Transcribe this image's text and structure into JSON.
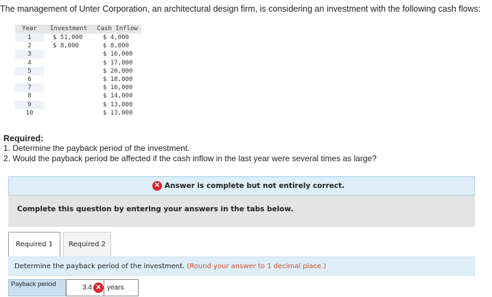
{
  "intro": "The management of Unter Corporation, an architectural design firm, is considering an investment with the following cash flows:",
  "table": {
    "headers": [
      "Year",
      "Investment",
      "Cash Inflow"
    ],
    "rows": [
      {
        "year": "1",
        "investment": "$ 51,000",
        "inflow": "$ 4,000"
      },
      {
        "year": "2",
        "investment": "$ 8,000",
        "inflow": "$ 8,000"
      },
      {
        "year": "3",
        "investment": "",
        "inflow": "$ 16,000"
      },
      {
        "year": "4",
        "investment": "",
        "inflow": "$ 17,000"
      },
      {
        "year": "5",
        "investment": "",
        "inflow": "$ 20,000"
      },
      {
        "year": "6",
        "investment": "",
        "inflow": "$ 18,000"
      },
      {
        "year": "7",
        "investment": "",
        "inflow": "$ 16,000"
      },
      {
        "year": "8",
        "investment": "",
        "inflow": "$ 14,000"
      },
      {
        "year": "9",
        "investment": "",
        "inflow": "$ 13,000"
      },
      {
        "year": "10",
        "investment": "",
        "inflow": "$ 13,000"
      }
    ]
  },
  "required": {
    "title": "Required:",
    "items": [
      "1. Determine the payback period of the investment.",
      "2. Would the payback period be affected if the cash inflow in the last year were several times as large?"
    ]
  },
  "status": {
    "icon": "incorrect-x-icon",
    "text": "Answer is complete but not entirely correct.",
    "color": "#d9232d"
  },
  "instruction": "Complete this question by entering your answers in the tabs below.",
  "tabs": [
    {
      "label": "Required 1"
    },
    {
      "label": "Required 2"
    }
  ],
  "question": {
    "text": "Determine the payback period of the investment.",
    "hint": "(Round your answer to 1 decimal place.)"
  },
  "answer": {
    "label": "Payback period",
    "value": "3.4",
    "unit": "years",
    "icon": "incorrect-x-icon"
  }
}
